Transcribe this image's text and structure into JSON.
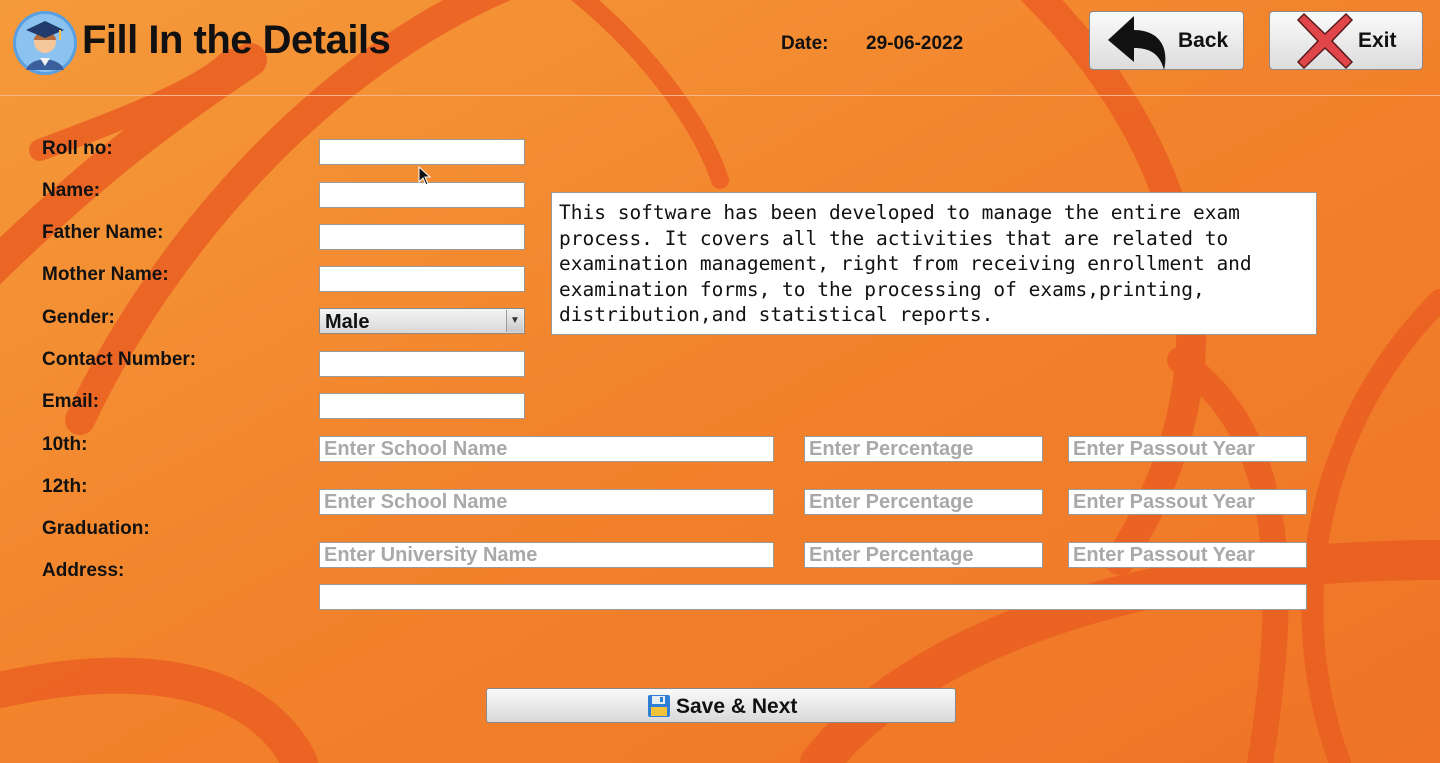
{
  "header": {
    "title": "Fill In the Details",
    "date_label": "Date:",
    "date_value": "29-06-2022",
    "back_label": "Back",
    "exit_label": "Exit"
  },
  "form": {
    "labels": {
      "roll_no": "Roll no:",
      "name": "Name:",
      "father_name": "Father Name:",
      "mother_name": "Mother Name:",
      "gender": "Gender:",
      "contact_number": "Contact Number:",
      "email": "Email:",
      "tenth": "10th:",
      "twelfth": "12th:",
      "graduation": "Graduation:",
      "address": "Address:"
    },
    "values": {
      "roll_no": "",
      "name": "",
      "father_name": "",
      "mother_name": "",
      "contact_number": "",
      "email": "",
      "address": ""
    },
    "gender_selected": "Male",
    "placeholders": {
      "school_name": "Enter School Name",
      "university_name": "Enter University Name",
      "percentage": "Enter Percentage",
      "passout_year": "Enter Passout Year"
    }
  },
  "description": "This software has been developed to manage the entire exam process. It covers all the activities that are related to examination management, right from receiving enrollment and examination forms, to the processing of exams,printing, distribution,and statistical reports.",
  "save_button": {
    "label": "Save & Next"
  },
  "icons": {
    "avatar": "graduate-avatar-icon",
    "back": "back-arrow-icon",
    "exit": "red-x-icon",
    "save": "floppy-disk-icon"
  },
  "colors": {
    "background": "#f2812a",
    "swirl": "#ea5f22",
    "exit_x": "#e0454a"
  }
}
